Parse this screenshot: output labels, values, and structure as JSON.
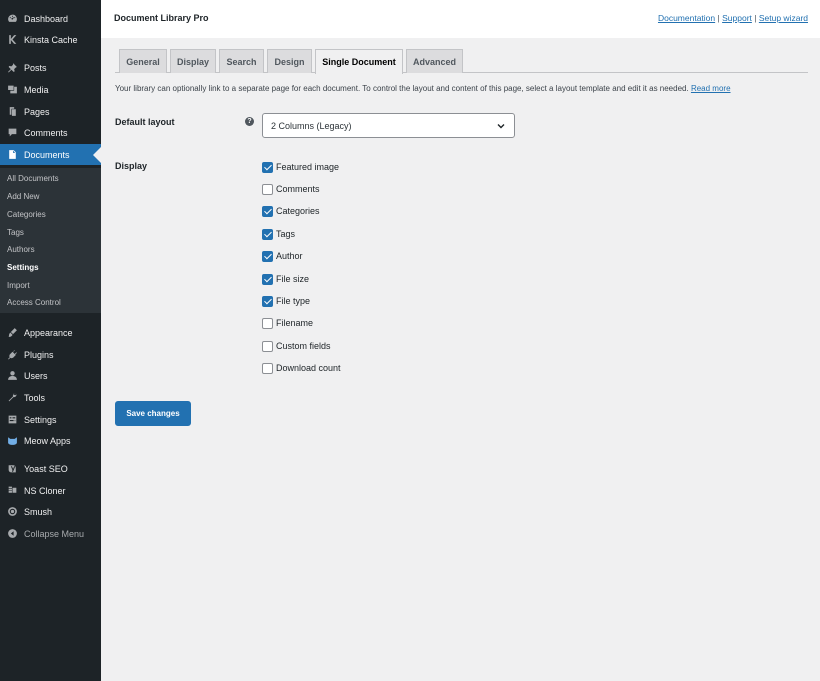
{
  "sidebar": {
    "menu": [
      {
        "label": "Dashboard",
        "icon": "dashboard-icon"
      },
      {
        "label": "Kinsta Cache",
        "icon": "kinsta-icon"
      },
      {
        "label": "Posts",
        "icon": "pin-icon"
      },
      {
        "label": "Media",
        "icon": "media-icon"
      },
      {
        "label": "Pages",
        "icon": "pages-icon"
      },
      {
        "label": "Comments",
        "icon": "comment-icon"
      },
      {
        "label": "Documents",
        "icon": "document-icon",
        "active": true
      },
      {
        "label": "Appearance",
        "icon": "brush-icon"
      },
      {
        "label": "Plugins",
        "icon": "plug-icon"
      },
      {
        "label": "Users",
        "icon": "user-icon"
      },
      {
        "label": "Tools",
        "icon": "wrench-icon"
      },
      {
        "label": "Settings",
        "icon": "settings-icon"
      },
      {
        "label": "Meow Apps",
        "icon": "meow-icon"
      },
      {
        "label": "Yoast SEO",
        "icon": "yoast-icon"
      },
      {
        "label": "NS Cloner",
        "icon": "cloner-icon"
      },
      {
        "label": "Smush",
        "icon": "smush-icon"
      },
      {
        "label": "Collapse Menu",
        "icon": "collapse-icon"
      }
    ],
    "submenu": [
      "All Documents",
      "Add New",
      "Categories",
      "Tags",
      "Authors",
      "Settings",
      "Import",
      "Access Control"
    ],
    "submenu_current": "Settings"
  },
  "header": {
    "title": "Document Library Pro",
    "links": [
      "Documentation",
      "Support",
      "Setup wizard"
    ],
    "separator": "|"
  },
  "tabs": [
    "General",
    "Display",
    "Search",
    "Design",
    "Single Document",
    "Advanced"
  ],
  "active_tab": "Single Document",
  "intro": {
    "text": "Your library can optionally link to a separate page for each document. To control the layout and content of this page, select a layout template and edit it as needed.",
    "link": "Read more"
  },
  "default_layout": {
    "label": "Default layout",
    "help": "?",
    "value": "2 Columns (Legacy)"
  },
  "display": {
    "label": "Display",
    "options": [
      {
        "label": "Featured image",
        "checked": true
      },
      {
        "label": "Comments",
        "checked": false
      },
      {
        "label": "Categories",
        "checked": true
      },
      {
        "label": "Tags",
        "checked": true
      },
      {
        "label": "Author",
        "checked": true
      },
      {
        "label": "File size",
        "checked": true
      },
      {
        "label": "File type",
        "checked": true
      },
      {
        "label": "Filename",
        "checked": false
      },
      {
        "label": "Custom fields",
        "checked": false
      },
      {
        "label": "Download count",
        "checked": false
      }
    ]
  },
  "save_label": "Save changes",
  "colors": {
    "sidebar": "#1d2327",
    "accent": "#2271b1",
    "background": "#f0f0f1"
  }
}
